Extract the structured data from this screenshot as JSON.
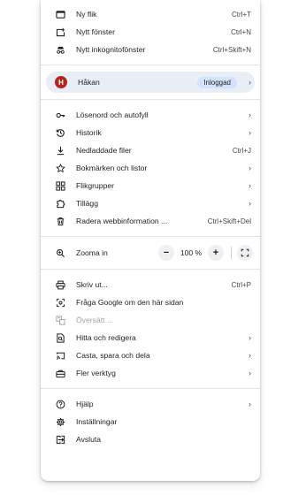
{
  "menu": {
    "group1": [
      {
        "label": "Ny flik",
        "shortcut": "Ctrl+T",
        "icon": "new-tab-icon"
      },
      {
        "label": "Nytt fönster",
        "shortcut": "Ctrl+N",
        "icon": "new-window-icon"
      },
      {
        "label": "Nytt inkognitofönster",
        "shortcut": "Ctrl+Skift+N",
        "icon": "incognito-icon"
      }
    ],
    "profile": {
      "initial": "H",
      "name": "Håkan",
      "status": "Inloggad",
      "avatar_color": "#b3261e"
    },
    "group2": [
      {
        "label": "Lösenord och autofyll",
        "icon": "key-icon",
        "submenu": true
      },
      {
        "label": "Historik",
        "icon": "history-icon",
        "submenu": true
      },
      {
        "label": "Nedladdade filer",
        "shortcut": "Ctrl+J",
        "icon": "download-icon"
      },
      {
        "label": "Bokmärken och listor",
        "icon": "star-icon",
        "submenu": true
      },
      {
        "label": "Flikgrupper",
        "icon": "tab-groups-icon",
        "submenu": true
      },
      {
        "label": "Tillägg",
        "icon": "extension-icon",
        "submenu": true
      },
      {
        "label": "Radera webbinformation ...",
        "shortcut": "Ctrl+Skift+Del",
        "icon": "trash-icon"
      }
    ],
    "zoom": {
      "label": "Zooma in",
      "value": "100 %",
      "minus": "−",
      "plus": "+"
    },
    "group3": [
      {
        "label": "Skriv ut...",
        "shortcut": "Ctrl+P",
        "icon": "print-icon"
      },
      {
        "label": "Fråga Google om den här sidan",
        "icon": "google-lens-icon"
      },
      {
        "label": "Översätt ...",
        "icon": "translate-icon",
        "disabled": true
      },
      {
        "label": "Hitta och redigera",
        "icon": "find-icon",
        "submenu": true
      },
      {
        "label": "Casta, spara och dela",
        "icon": "cast-icon",
        "submenu": true
      },
      {
        "label": "Fler verktyg",
        "icon": "toolbox-icon",
        "submenu": true
      }
    ],
    "group4": [
      {
        "label": "Hjälp",
        "icon": "help-icon",
        "submenu": true
      },
      {
        "label": "Inställningar",
        "icon": "settings-icon"
      },
      {
        "label": "Avsluta",
        "icon": "exit-icon"
      }
    ],
    "chevron": "›"
  }
}
